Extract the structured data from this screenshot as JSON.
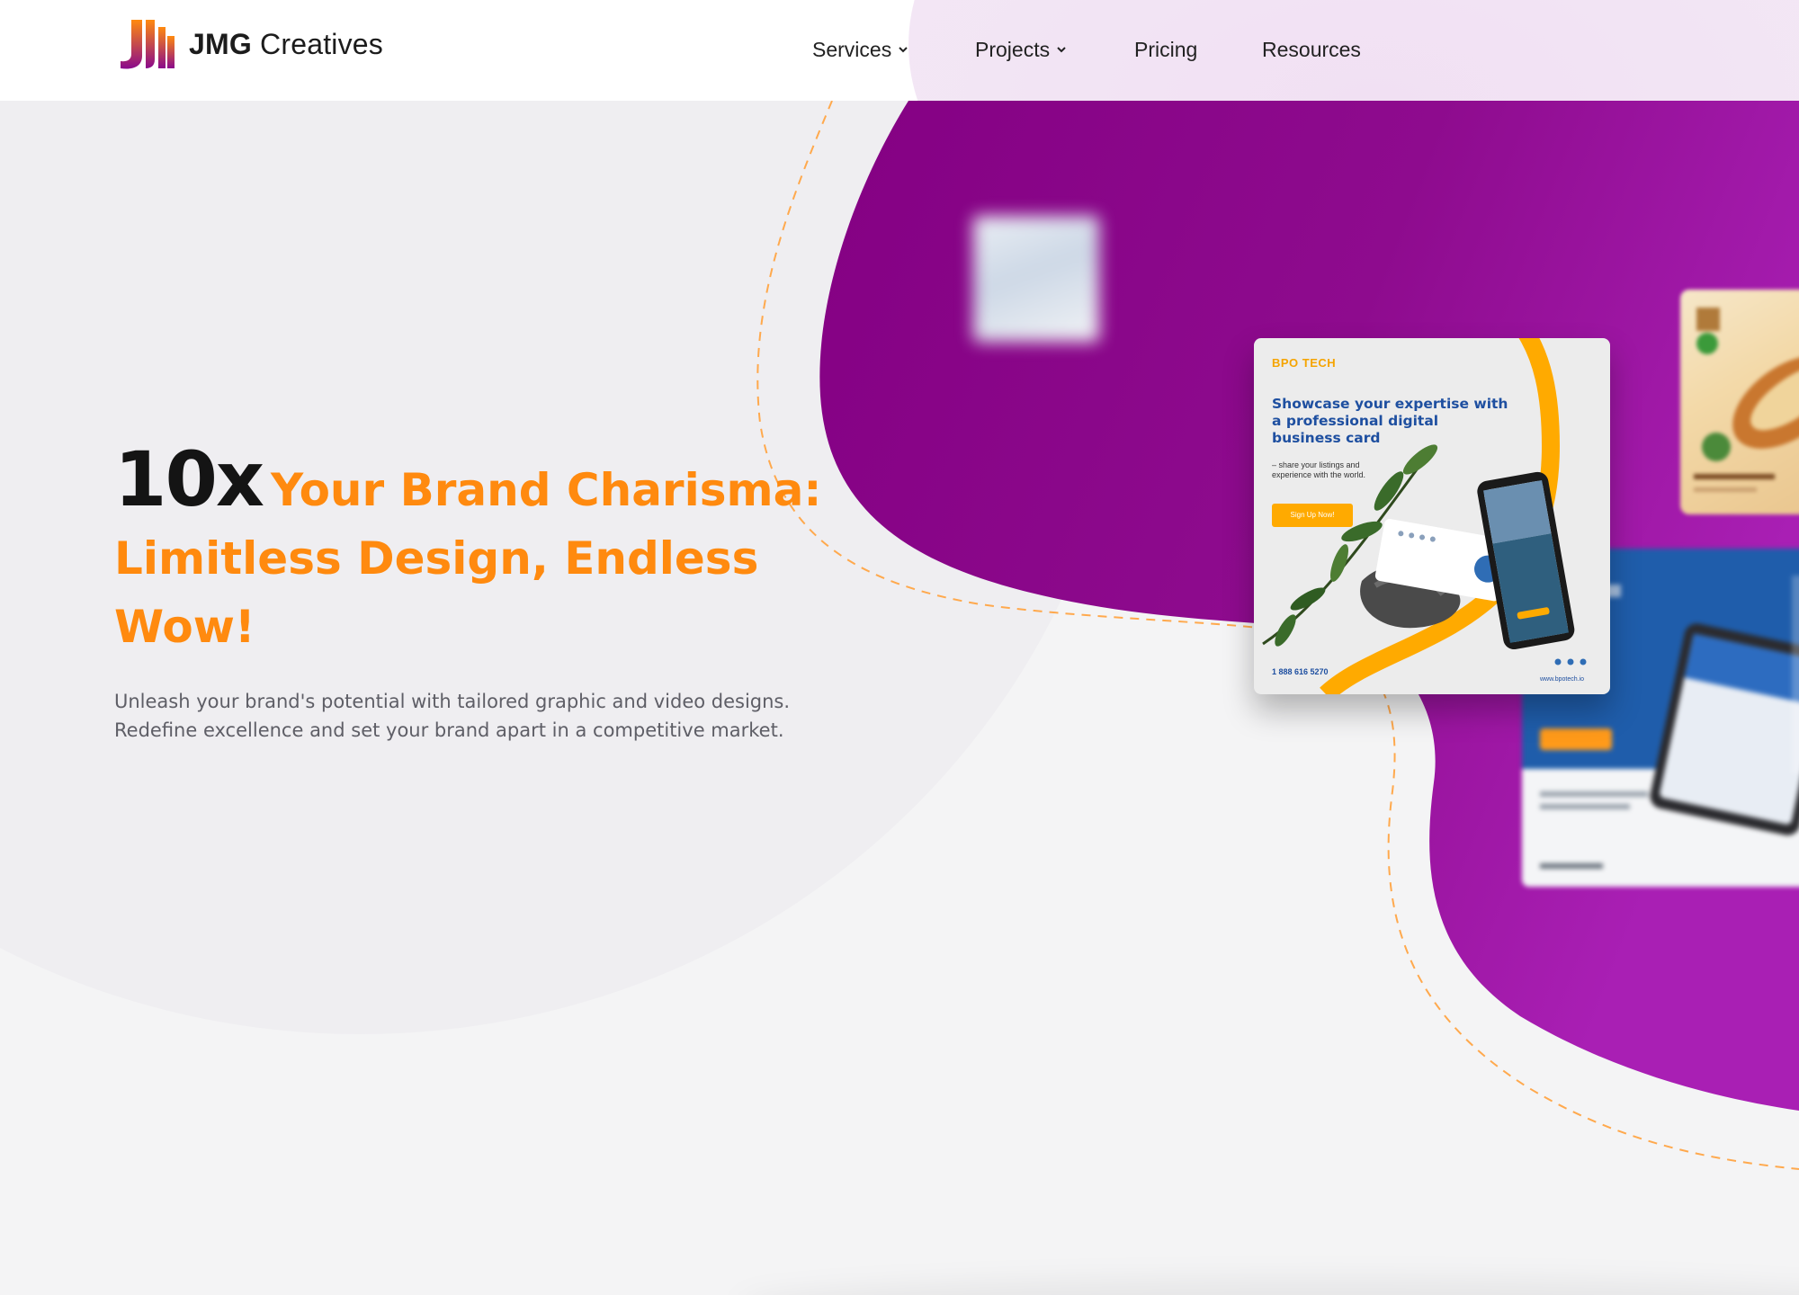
{
  "brand": {
    "name_bold": "JMG",
    "name_rest": "Creatives",
    "logo_icon": "jmg-logo-mark",
    "accent_colors": {
      "orange": "#ff8a0f",
      "purple": "#8a0a8c",
      "dark": "#141414"
    }
  },
  "nav": {
    "items": [
      {
        "label": "Services",
        "has_dropdown": true
      },
      {
        "label": "Projects",
        "has_dropdown": true
      },
      {
        "label": "Pricing",
        "has_dropdown": false
      },
      {
        "label": "Resources",
        "has_dropdown": false
      }
    ]
  },
  "hero": {
    "headline_big": "10x",
    "headline_line1": "Your Brand Charisma:",
    "headline_line2": "Limitless Design, Endless Wow!",
    "subtext_line1": "Unleash your brand's potential with tailored graphic and video designs.",
    "subtext_line2": "Redefine excellence and set your brand apart in a competitive market."
  },
  "showcase": {
    "main_card": {
      "brand": "BPO TECH",
      "title_line1": "Showcase your expertise with",
      "title_line2": "a professional digital",
      "title_line3": "business card",
      "desc_line1": "– share your listings and",
      "desc_line2": "experience with the world.",
      "button": "Sign Up Now!",
      "phone": "1 888 616 5270",
      "website": "www.bpotech.io"
    }
  }
}
